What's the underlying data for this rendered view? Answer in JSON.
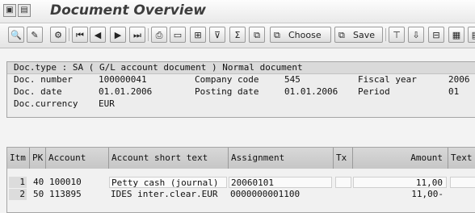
{
  "window": {
    "title": "Document Overview",
    "title_icons": [
      "screen-icon",
      "page-icon"
    ]
  },
  "toolbar": {
    "choose_label": "Choose",
    "save_label": "Save"
  },
  "header": {
    "doc_type_line": "Doc.type : SA ( G/L account document ) Normal document",
    "fields": {
      "doc_number_label": "Doc. number",
      "doc_number": "100000041",
      "company_code_label": "Company code",
      "company_code": "545",
      "fiscal_year_label": "Fiscal year",
      "fiscal_year": "2006",
      "doc_date_label": "Doc. date",
      "doc_date": "01.01.2006",
      "posting_date_label": "Posting date",
      "posting_date": "01.01.2006",
      "period_label": "Period",
      "period": "01",
      "currency_label": "Doc.currency",
      "currency": "EUR"
    }
  },
  "table": {
    "columns": [
      "Itm",
      "PK",
      "Account",
      "Account short text",
      "Assignment",
      "Tx",
      "Amount",
      "Text"
    ],
    "rows": [
      {
        "itm": "1",
        "pk": "40",
        "account": "100010",
        "short_text": "Petty cash (journal)",
        "assignment": "20060101",
        "tx": "",
        "amount": "11,00",
        "text": ""
      },
      {
        "itm": "2",
        "pk": "50",
        "account": "113895",
        "short_text": "IDES inter.clear.EUR",
        "assignment": "0000000001100",
        "tx": "",
        "amount": "11,00-",
        "text": ""
      }
    ]
  }
}
